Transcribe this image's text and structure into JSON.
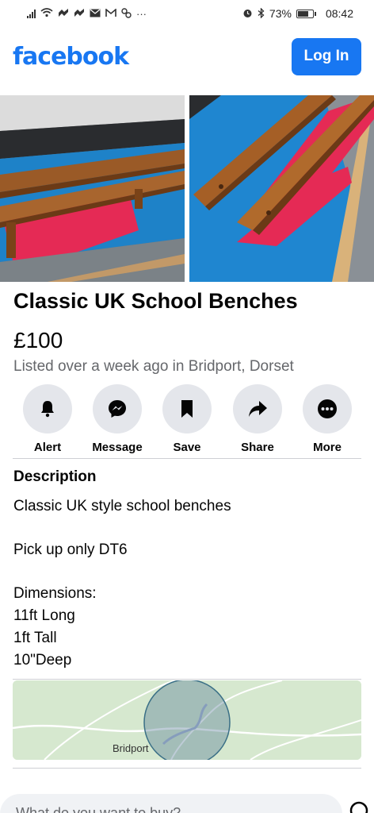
{
  "status_bar": {
    "battery": "73%",
    "time": "08:42",
    "battery_level": 0.73,
    "left_icons": [
      "signal-icon",
      "wifi-icon",
      "notification-icon",
      "notification-icon",
      "mail-icon",
      "gmail-icon",
      "app-icon",
      "more-dots-icon"
    ],
    "right_icons": [
      "alarm-icon",
      "bluetooth-icon",
      "battery-icon"
    ]
  },
  "header": {
    "logo_text": "facebook",
    "login_label": "Log In",
    "brand_color": "#1877f2"
  },
  "listing": {
    "title": "Classic UK School Benches",
    "price": "£100",
    "listed": "Listed over a week ago in Bridport, Dorset"
  },
  "actions": [
    {
      "label": "Alert",
      "icon": "bell-icon"
    },
    {
      "label": "Message",
      "icon": "messenger-icon"
    },
    {
      "label": "Save",
      "icon": "bookmark-icon"
    },
    {
      "label": "Share",
      "icon": "share-icon"
    },
    {
      "label": "More",
      "icon": "more-icon"
    }
  ],
  "description": {
    "heading": "Description",
    "lines": [
      "Classic UK style school benches",
      "Pick up only DT6",
      "Dimensions:",
      "11ft Long",
      "1ft Tall",
      "10\"Deep"
    ]
  },
  "map": {
    "place_label": "Bridport"
  },
  "bottom": {
    "search_prompt": "What do you want to buy?"
  }
}
